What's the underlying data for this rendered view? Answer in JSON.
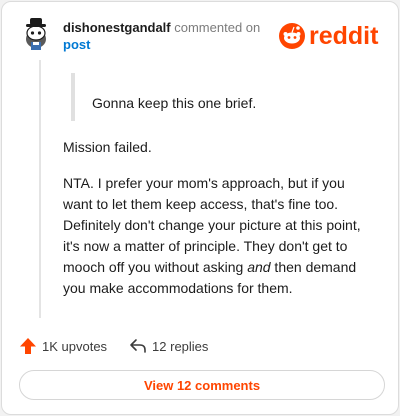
{
  "comment": {
    "username": "dishonestgandalf",
    "action": "commented on",
    "target": "post",
    "quote": "Gonna keep this one brief.",
    "paragraph1": "Mission failed.",
    "paragraph2_lines": [
      "NTA. I prefer your mom's approach, but if you",
      "want to let them keep access, that's fine too.",
      "Definitely don't change your picture at this point,",
      "it's now a matter of principle. They don't get to",
      "mooch off you without asking ",
      "you make accommodations for them."
    ],
    "emphasis_word": "and",
    "after_emphasis": " then demand"
  },
  "brand": {
    "logo_text": "reddit",
    "accent": "#ff4500"
  },
  "actions": {
    "upvotes": "1K upvotes",
    "replies": "12 replies"
  },
  "view_button": {
    "label": "View 12 comments"
  },
  "icons": {
    "avatar": "snoo-avatar-icon",
    "logo": "reddit-logo-icon",
    "upvote": "upvote-arrow-icon",
    "reply": "reply-arrow-icon"
  }
}
